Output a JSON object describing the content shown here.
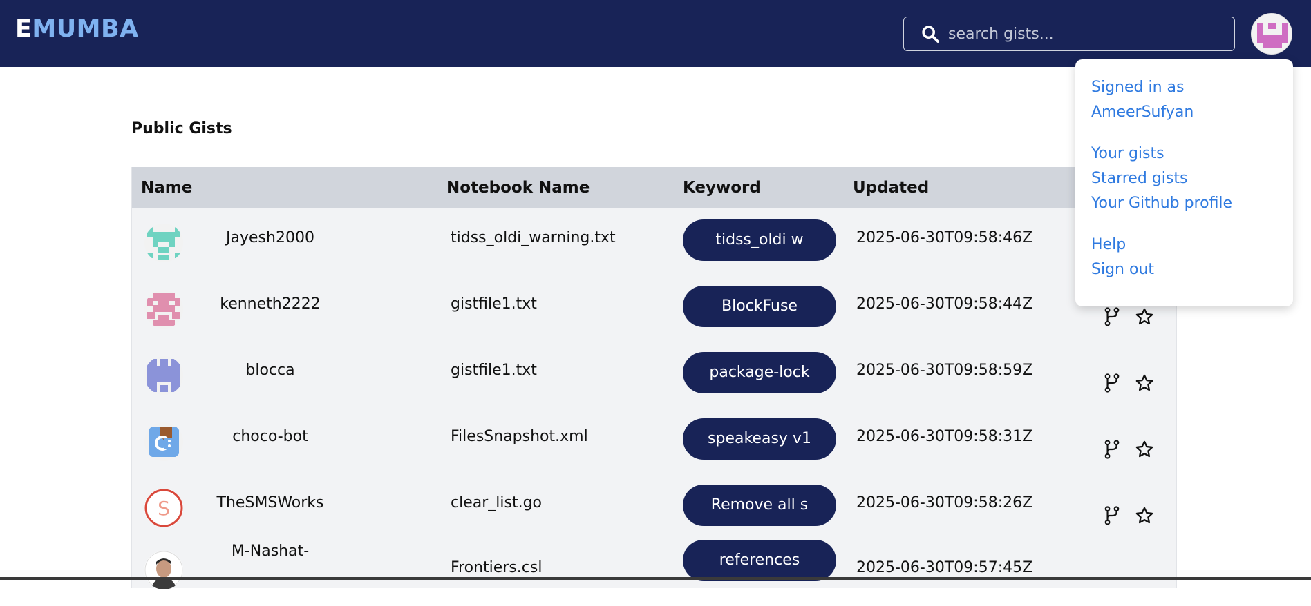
{
  "header": {
    "logo_part1": "E",
    "logo_part2": "MUMBA",
    "search_placeholder": "search gists..."
  },
  "main": {
    "title": "Public Gists",
    "columns": {
      "name": "Name",
      "notebook": "Notebook Name",
      "keyword": "Keyword",
      "updated": "Updated"
    },
    "rows": [
      {
        "name": "Jayesh2000",
        "notebook": "tidss_oldi_warning.txt",
        "keyword": "tidss_oldi w",
        "updated": "2025-06-30T09:58:46Z"
      },
      {
        "name": "kenneth2222",
        "notebook": "gistfile1.txt",
        "keyword": "BlockFuse",
        "updated": "2025-06-30T09:58:44Z"
      },
      {
        "name": "blocca",
        "notebook": "gistfile1.txt",
        "keyword": "package-lock",
        "updated": "2025-06-30T09:58:59Z"
      },
      {
        "name": "choco-bot",
        "notebook": "FilesSnapshot.xml",
        "keyword": "speakeasy v1",
        "updated": "2025-06-30T09:58:31Z"
      },
      {
        "name": "TheSMSWorks",
        "notebook": "clear_list.go",
        "keyword": "Remove all s",
        "updated": "2025-06-30T09:58:26Z"
      },
      {
        "name": "M-Nashat-",
        "notebook": "Frontiers.csl",
        "keyword": "references",
        "updated": "2025-06-30T09:57:45Z"
      }
    ]
  },
  "dropdown": {
    "signed_in_line1": "Signed in as",
    "signed_in_line2": "AmeerSufyan",
    "your_gists": "Your gists",
    "starred_gists": "Starred gists",
    "github_profile": "Your Github profile",
    "help": "Help",
    "sign_out": "Sign out"
  },
  "colors": {
    "header_bg": "#182357",
    "logo_accent": "#7fb2f0",
    "keyword_pill": "#182357",
    "link": "#2f7ae0",
    "table_header": "#d1d5dc",
    "table_body": "#f2f3f5"
  },
  "icons": {
    "search": "search-icon",
    "fork": "fork-icon",
    "star": "star-icon"
  }
}
